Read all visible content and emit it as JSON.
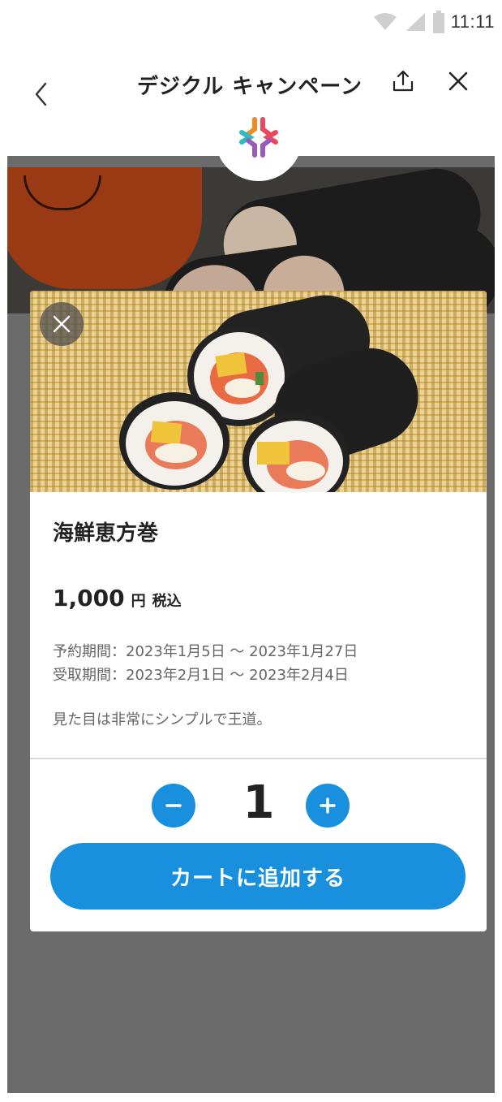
{
  "status_bar": {
    "time": "11:11"
  },
  "header": {
    "title": "デジクル キャンペーン"
  },
  "product": {
    "name": "海鮮恵方巻",
    "price": "1,000",
    "price_unit": "円",
    "tax_label": "税込",
    "reservation_period": "予約期間：2023年1月5日 ～ 2023年1月27日",
    "pickup_period": "受取期間：2023年2月1日 ～ 2023年2月4日",
    "description": "見た目は非常にシンプルで王道。"
  },
  "quantity": {
    "value": "1"
  },
  "cart": {
    "add_label": "カートに追加する"
  },
  "colors": {
    "accent": "#1890dd",
    "overlay": "#6b6b6b",
    "logo_orange": "#f08a24",
    "logo_red": "#e8495c",
    "logo_teal": "#2fb9c4",
    "logo_purple": "#9b5bb8"
  },
  "icons": {
    "back": "chevron-left-icon",
    "share": "share-icon",
    "close": "close-icon",
    "photo_close": "close-icon",
    "minus": "minus-icon",
    "plus": "plus-icon",
    "wifi": "wifi-icon",
    "signal": "signal-icon",
    "battery": "battery-icon"
  }
}
